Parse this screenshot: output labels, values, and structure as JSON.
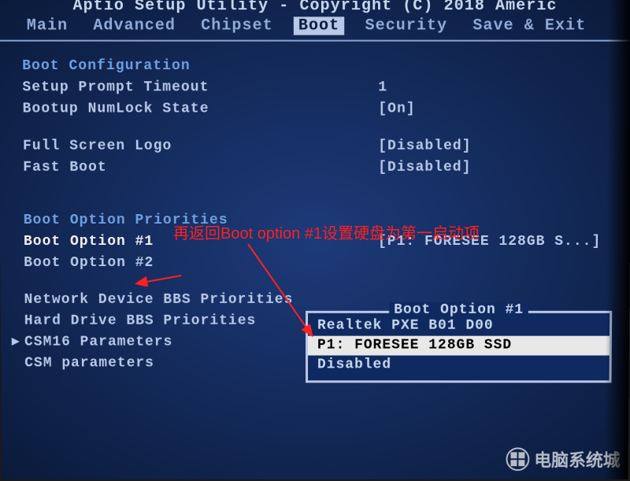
{
  "title": "Aptio Setup Utility - Copyright (C) 2018 Americ",
  "menu": {
    "items": [
      "Main",
      "Advanced",
      "Chipset",
      "Boot",
      "Security",
      "Save & Exit"
    ],
    "active": "Boot"
  },
  "sections": {
    "boot_config_header": "Boot Configuration",
    "setup_prompt_timeout": {
      "label": "Setup Prompt Timeout",
      "value": "1"
    },
    "bootup_numlock": {
      "label": "Bootup NumLock State",
      "value": "[On]"
    },
    "full_screen_logo": {
      "label": "Full Screen Logo",
      "value": "[Disabled]"
    },
    "fast_boot": {
      "label": "Fast Boot",
      "value": "[Disabled]"
    },
    "boot_priorities_header": "Boot Option Priorities",
    "boot_option_1": {
      "label": "Boot Option #1",
      "value": "[P1: FORESEE 128GB S...]"
    },
    "boot_option_2": {
      "label": "Boot Option #2",
      "value": ""
    },
    "network_bbs": "Network Device BBS Priorities",
    "hard_drive_bbs": "Hard Drive BBS Priorities",
    "csm16": "CSM16 Parameters",
    "csm": "CSM parameters"
  },
  "popup": {
    "title": "Boot Option #1",
    "items": [
      "Realtek PXE B01 D00",
      "P1: FORESEE 128GB SSD",
      "Disabled"
    ],
    "highlighted": "P1: FORESEE 128GB SSD"
  },
  "annotation": "再返回Boot option #1设置硬盘为第一启动项",
  "watermark": "电脑系统城"
}
